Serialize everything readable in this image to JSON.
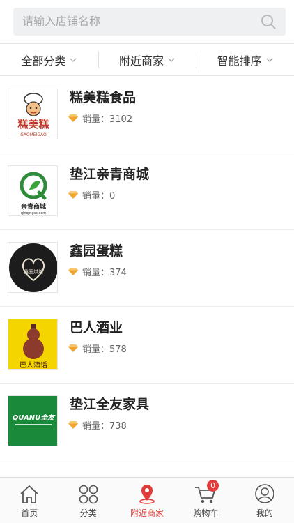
{
  "search": {
    "placeholder": "请输入店铺名称"
  },
  "filters": [
    {
      "label": "全部分类"
    },
    {
      "label": "附近商家"
    },
    {
      "label": "智能排序"
    }
  ],
  "shops": [
    {
      "name": "糕美糕食品",
      "sales": "销量：3102",
      "logo": "gaomeigao-logo",
      "logo_text": "糕美糕",
      "logo_sub": "GAOMEIGAO"
    },
    {
      "name": "垫江亲青商城",
      "sales": "销量：0",
      "logo": "qinqing-logo",
      "logo_text": "亲青商城",
      "logo_sub": "qinqingsc.com"
    },
    {
      "name": "鑫园蛋糕",
      "sales": "销量：374",
      "logo": "xinyuan-logo",
      "logo_text": "鑫园烘焙"
    },
    {
      "name": "巴人酒业",
      "sales": "销量：578",
      "logo": "baren-logo",
      "logo_text": "巴人酒话"
    },
    {
      "name": "垫江全友家具",
      "sales": "销量：738",
      "logo": "quanyou-logo",
      "logo_text": "QUANU全友"
    }
  ],
  "tabbar": {
    "items": [
      {
        "label": "首页",
        "icon": "home-icon"
      },
      {
        "label": "分类",
        "icon": "category-icon"
      },
      {
        "label": "附近商家",
        "icon": "location-pin-icon",
        "active": true
      },
      {
        "label": "购物车",
        "icon": "cart-icon",
        "badge": "0"
      },
      {
        "label": "我的",
        "icon": "user-icon"
      }
    ]
  },
  "colors": {
    "accent": "#e23b3b",
    "badge": "#e43b3b",
    "diamond": "#f0a531"
  }
}
